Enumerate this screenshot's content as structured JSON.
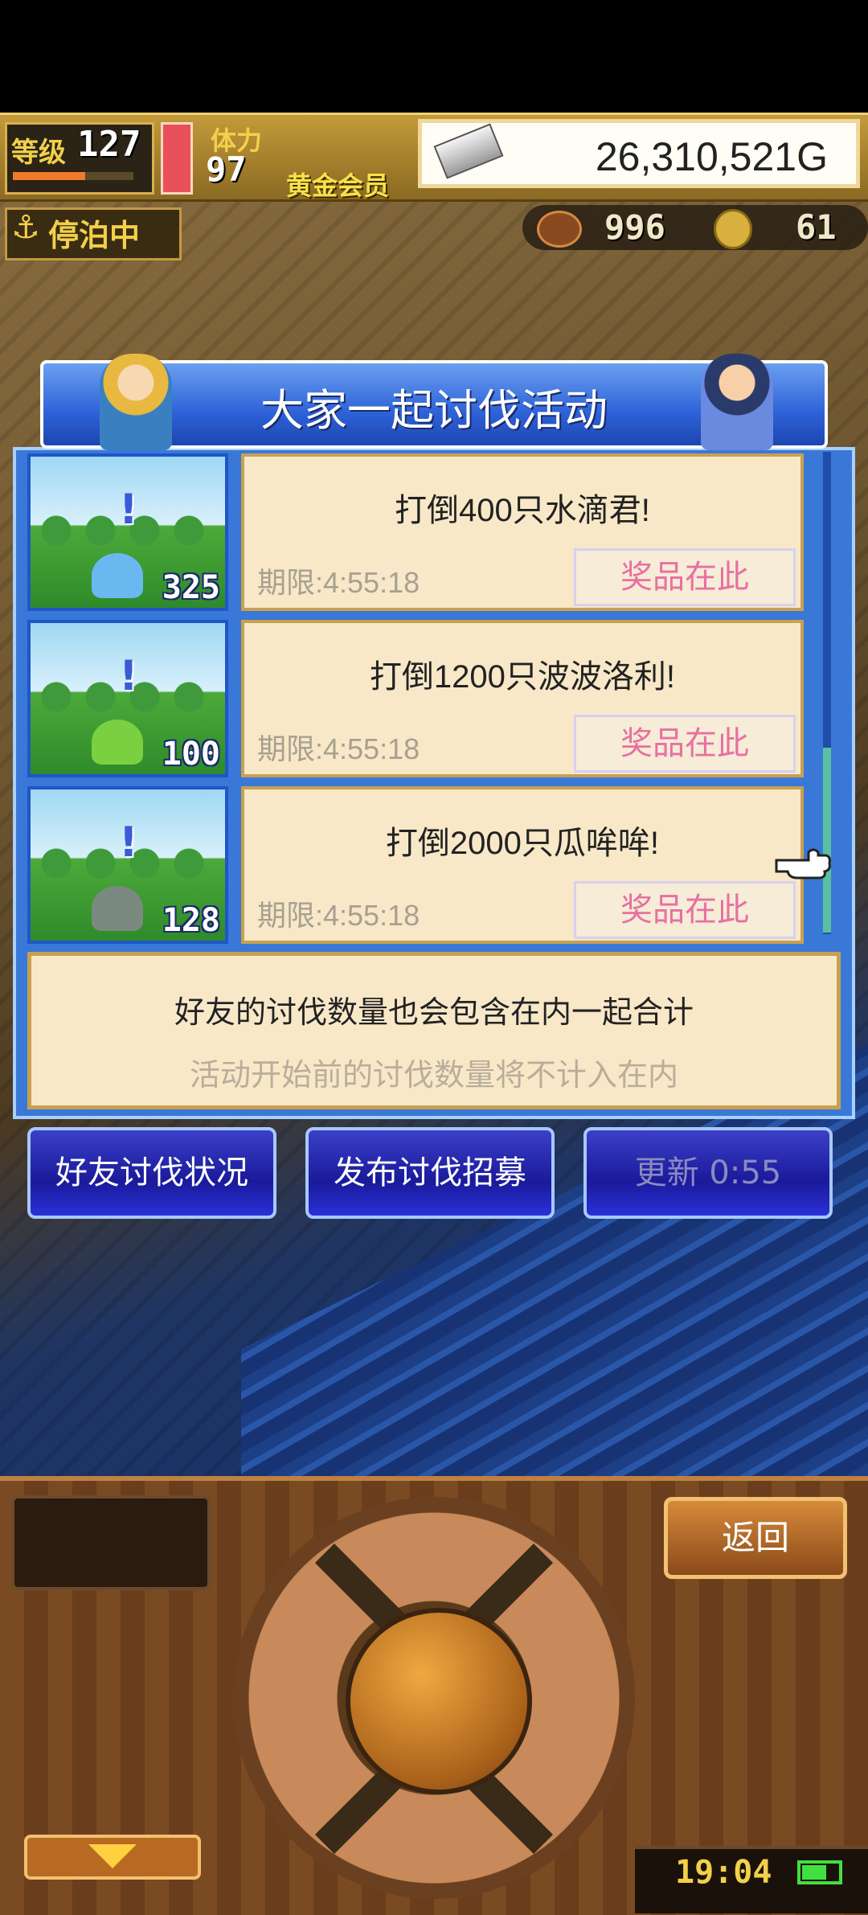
{
  "hud": {
    "level_label": "等级",
    "level_value": "127",
    "stamina_label": "体力",
    "stamina_value": "97",
    "membership": "黄金会员",
    "money": "26,310,521G",
    "status": "停泊中",
    "resource1": "996",
    "resource2": "61"
  },
  "dialog": {
    "title": "大家一起讨伐活动",
    "missions": [
      {
        "title": "打倒400只水滴君!",
        "deadline": "期限:4:55:18",
        "prize_label": "奖品在此",
        "count": "325",
        "monster_color": "#6ab8f0"
      },
      {
        "title": "打倒1200只波波洛利!",
        "deadline": "期限:4:55:18",
        "prize_label": "奖品在此",
        "count": "100",
        "monster_color": "#7ad040"
      },
      {
        "title": "打倒2000只瓜哞哞!",
        "deadline": "期限:4:55:18",
        "prize_label": "奖品在此",
        "count": "128",
        "monster_color": "#7a8a80"
      }
    ],
    "info_line1": "好友的讨伐数量也会包含在内一起合计",
    "info_line2": "活动开始前的讨伐数量将不计入在内"
  },
  "buttons": {
    "friend_status": "好友讨伐状况",
    "post_recruit": "发布讨伐招募",
    "refresh": "更新 0:55"
  },
  "panel": {
    "back": "返回",
    "time": "19:04"
  }
}
